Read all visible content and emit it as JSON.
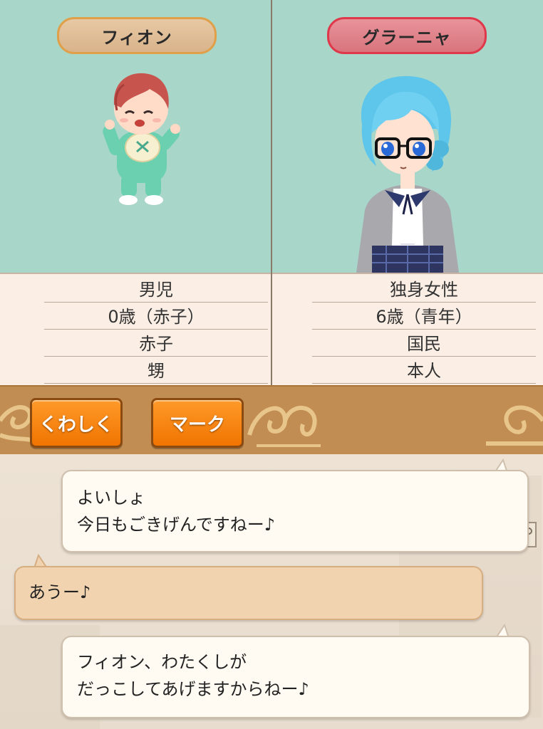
{
  "left_character": {
    "name": "フィオン",
    "attributes": [
      "男児",
      "0歳（赤子）",
      "赤子",
      "甥"
    ]
  },
  "right_character": {
    "name": "グラーニャ",
    "attributes": [
      "独身女性",
      "6歳（青年）",
      "国民",
      "本人"
    ]
  },
  "buttons": {
    "details": "くわしく",
    "mark": "マーク"
  },
  "dialogue": [
    {
      "lines": [
        "よいしょ",
        "今日もごきげんですねー♪"
      ]
    },
    {
      "lines": [
        "あうー♪"
      ]
    },
    {
      "lines": [
        "フィオン、わたくしが",
        "だっこしてあげますからねー♪"
      ]
    }
  ],
  "colors": {
    "panel_bg": "#a8d6c8",
    "left_tag_border": "#e0a04a",
    "right_tag_border": "#e0384b",
    "button_orange": "#f07400",
    "bar_brown": "#c28d52"
  }
}
